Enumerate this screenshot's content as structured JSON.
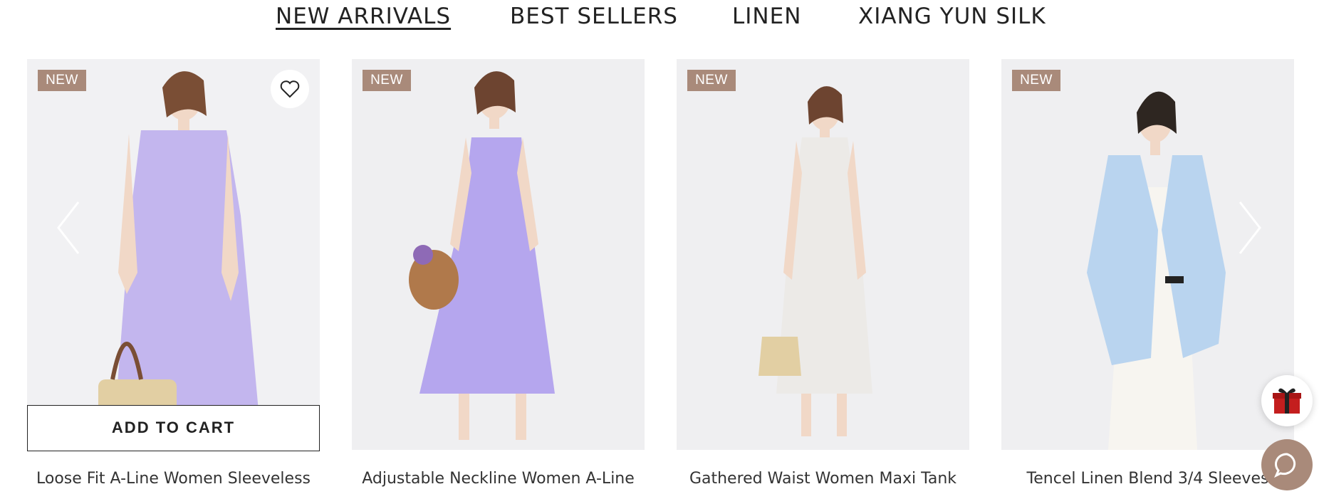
{
  "tabs": [
    "NEW ARRIVALS",
    "BEST SELLERS",
    "LINEN",
    "XIANG YUN SILK"
  ],
  "active_tab": "NEW ARRIVALS",
  "products": [
    {
      "badge": "NEW",
      "title": "Loose Fit A-Line Women Sleeveless",
      "dress_color": "#c3b6ee"
    },
    {
      "badge": "NEW",
      "title": "Adjustable Neckline Women A-Line",
      "dress_color": "#b5a6ee"
    },
    {
      "badge": "NEW",
      "title": "Gathered Waist Women Maxi Tank",
      "dress_color": "#eceae7"
    },
    {
      "badge": "NEW",
      "title": "Tencel Linen Blend 3/4 Sleeves",
      "dress_color": "#b9d4ef"
    }
  ],
  "add_to_cart_label": "ADD TO CART",
  "colors": {
    "badge": "#a98a7a",
    "accent": "#a98a7a",
    "text": "#222222"
  },
  "icons": {
    "wishlist": "heart-icon",
    "prev": "chevron-left-icon",
    "next": "chevron-right-icon",
    "gift": "gift-icon",
    "chat": "chat-icon"
  }
}
